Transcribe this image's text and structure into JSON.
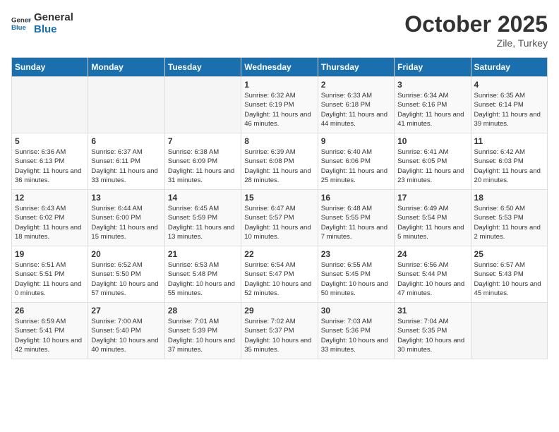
{
  "header": {
    "logo_general": "General",
    "logo_blue": "Blue",
    "month_title": "October 2025",
    "location": "Zile, Turkey"
  },
  "weekdays": [
    "Sunday",
    "Monday",
    "Tuesday",
    "Wednesday",
    "Thursday",
    "Friday",
    "Saturday"
  ],
  "weeks": [
    [
      {
        "day": "",
        "info": ""
      },
      {
        "day": "",
        "info": ""
      },
      {
        "day": "",
        "info": ""
      },
      {
        "day": "1",
        "info": "Sunrise: 6:32 AM\nSunset: 6:19 PM\nDaylight: 11 hours and 46 minutes."
      },
      {
        "day": "2",
        "info": "Sunrise: 6:33 AM\nSunset: 6:18 PM\nDaylight: 11 hours and 44 minutes."
      },
      {
        "day": "3",
        "info": "Sunrise: 6:34 AM\nSunset: 6:16 PM\nDaylight: 11 hours and 41 minutes."
      },
      {
        "day": "4",
        "info": "Sunrise: 6:35 AM\nSunset: 6:14 PM\nDaylight: 11 hours and 39 minutes."
      }
    ],
    [
      {
        "day": "5",
        "info": "Sunrise: 6:36 AM\nSunset: 6:13 PM\nDaylight: 11 hours and 36 minutes."
      },
      {
        "day": "6",
        "info": "Sunrise: 6:37 AM\nSunset: 6:11 PM\nDaylight: 11 hours and 33 minutes."
      },
      {
        "day": "7",
        "info": "Sunrise: 6:38 AM\nSunset: 6:09 PM\nDaylight: 11 hours and 31 minutes."
      },
      {
        "day": "8",
        "info": "Sunrise: 6:39 AM\nSunset: 6:08 PM\nDaylight: 11 hours and 28 minutes."
      },
      {
        "day": "9",
        "info": "Sunrise: 6:40 AM\nSunset: 6:06 PM\nDaylight: 11 hours and 25 minutes."
      },
      {
        "day": "10",
        "info": "Sunrise: 6:41 AM\nSunset: 6:05 PM\nDaylight: 11 hours and 23 minutes."
      },
      {
        "day": "11",
        "info": "Sunrise: 6:42 AM\nSunset: 6:03 PM\nDaylight: 11 hours and 20 minutes."
      }
    ],
    [
      {
        "day": "12",
        "info": "Sunrise: 6:43 AM\nSunset: 6:02 PM\nDaylight: 11 hours and 18 minutes."
      },
      {
        "day": "13",
        "info": "Sunrise: 6:44 AM\nSunset: 6:00 PM\nDaylight: 11 hours and 15 minutes."
      },
      {
        "day": "14",
        "info": "Sunrise: 6:45 AM\nSunset: 5:59 PM\nDaylight: 11 hours and 13 minutes."
      },
      {
        "day": "15",
        "info": "Sunrise: 6:47 AM\nSunset: 5:57 PM\nDaylight: 11 hours and 10 minutes."
      },
      {
        "day": "16",
        "info": "Sunrise: 6:48 AM\nSunset: 5:55 PM\nDaylight: 11 hours and 7 minutes."
      },
      {
        "day": "17",
        "info": "Sunrise: 6:49 AM\nSunset: 5:54 PM\nDaylight: 11 hours and 5 minutes."
      },
      {
        "day": "18",
        "info": "Sunrise: 6:50 AM\nSunset: 5:53 PM\nDaylight: 11 hours and 2 minutes."
      }
    ],
    [
      {
        "day": "19",
        "info": "Sunrise: 6:51 AM\nSunset: 5:51 PM\nDaylight: 11 hours and 0 minutes."
      },
      {
        "day": "20",
        "info": "Sunrise: 6:52 AM\nSunset: 5:50 PM\nDaylight: 10 hours and 57 minutes."
      },
      {
        "day": "21",
        "info": "Sunrise: 6:53 AM\nSunset: 5:48 PM\nDaylight: 10 hours and 55 minutes."
      },
      {
        "day": "22",
        "info": "Sunrise: 6:54 AM\nSunset: 5:47 PM\nDaylight: 10 hours and 52 minutes."
      },
      {
        "day": "23",
        "info": "Sunrise: 6:55 AM\nSunset: 5:45 PM\nDaylight: 10 hours and 50 minutes."
      },
      {
        "day": "24",
        "info": "Sunrise: 6:56 AM\nSunset: 5:44 PM\nDaylight: 10 hours and 47 minutes."
      },
      {
        "day": "25",
        "info": "Sunrise: 6:57 AM\nSunset: 5:43 PM\nDaylight: 10 hours and 45 minutes."
      }
    ],
    [
      {
        "day": "26",
        "info": "Sunrise: 6:59 AM\nSunset: 5:41 PM\nDaylight: 10 hours and 42 minutes."
      },
      {
        "day": "27",
        "info": "Sunrise: 7:00 AM\nSunset: 5:40 PM\nDaylight: 10 hours and 40 minutes."
      },
      {
        "day": "28",
        "info": "Sunrise: 7:01 AM\nSunset: 5:39 PM\nDaylight: 10 hours and 37 minutes."
      },
      {
        "day": "29",
        "info": "Sunrise: 7:02 AM\nSunset: 5:37 PM\nDaylight: 10 hours and 35 minutes."
      },
      {
        "day": "30",
        "info": "Sunrise: 7:03 AM\nSunset: 5:36 PM\nDaylight: 10 hours and 33 minutes."
      },
      {
        "day": "31",
        "info": "Sunrise: 7:04 AM\nSunset: 5:35 PM\nDaylight: 10 hours and 30 minutes."
      },
      {
        "day": "",
        "info": ""
      }
    ]
  ]
}
